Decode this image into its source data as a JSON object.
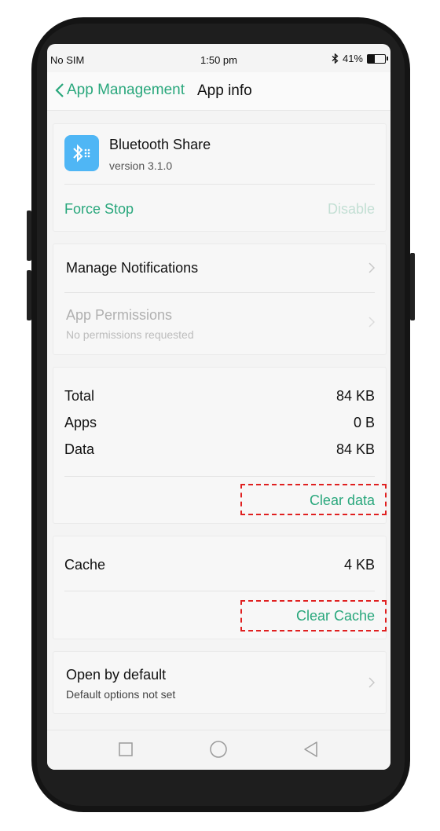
{
  "status_bar": {
    "carrier": "No SIM",
    "time": "1:50 pm",
    "battery_percent": "41%",
    "battery_level": 0.41,
    "bluetooth_icon": "bluetooth-icon"
  },
  "header": {
    "back_label": "App Management",
    "title": "App info"
  },
  "app": {
    "name": "Bluetooth Share",
    "version": "version 3.1.0",
    "icon": "bluetooth-app-icon",
    "force_stop_label": "Force Stop",
    "disable_label": "Disable"
  },
  "permissions_card": {
    "manage_notifications": "Manage Notifications",
    "app_permissions": "App Permissions",
    "app_permissions_sub": "No permissions requested"
  },
  "storage": {
    "rows": [
      {
        "label": "Total",
        "value": "84 KB"
      },
      {
        "label": "Apps",
        "value": "0 B"
      },
      {
        "label": "Data",
        "value": "84 KB"
      }
    ],
    "clear_data_label": "Clear data"
  },
  "cache": {
    "label": "Cache",
    "value": "4 KB",
    "clear_cache_label": "Clear Cache"
  },
  "default_card": {
    "title": "Open by default",
    "subtitle": "Default options not set"
  },
  "colors": {
    "accent": "#29a77c",
    "highlight": "#e02020",
    "app_icon": "#4fb6f5"
  },
  "nav_icons": [
    "recents-square-icon",
    "home-circle-icon",
    "back-triangle-icon"
  ]
}
